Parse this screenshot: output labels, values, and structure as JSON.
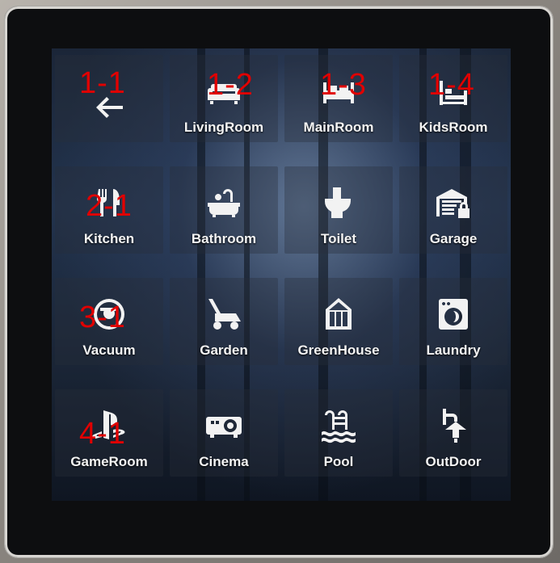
{
  "tiles": [
    {
      "id": "back",
      "label": "",
      "icon": "back-arrow-icon",
      "tag": "1-1"
    },
    {
      "id": "livingroom",
      "label": "LivingRoom",
      "icon": "sofa-icon",
      "tag": "1-2"
    },
    {
      "id": "mainroom",
      "label": "MainRoom",
      "icon": "bed-icon",
      "tag": "1-3"
    },
    {
      "id": "kidsroom",
      "label": "KidsRoom",
      "icon": "single-bed-icon",
      "tag": "1-4"
    },
    {
      "id": "kitchen",
      "label": "Kitchen",
      "icon": "fork-knife-icon",
      "tag": "2-1"
    },
    {
      "id": "bathroom",
      "label": "Bathroom",
      "icon": "bathtub-icon",
      "tag": ""
    },
    {
      "id": "toilet",
      "label": "Toilet",
      "icon": "toilet-icon",
      "tag": ""
    },
    {
      "id": "garage",
      "label": "Garage",
      "icon": "garage-lock-icon",
      "tag": ""
    },
    {
      "id": "vacuum",
      "label": "Vacuum",
      "icon": "robot-vacuum-icon",
      "tag": "3-1"
    },
    {
      "id": "garden",
      "label": "Garden",
      "icon": "lawn-mower-icon",
      "tag": ""
    },
    {
      "id": "greenhouse",
      "label": "GreenHouse",
      "icon": "greenhouse-icon",
      "tag": ""
    },
    {
      "id": "laundry",
      "label": "Laundry",
      "icon": "washing-machine-icon",
      "tag": ""
    },
    {
      "id": "gameroom",
      "label": "GameRoom",
      "icon": "playstation-icon",
      "tag": "4-1"
    },
    {
      "id": "cinema",
      "label": "Cinema",
      "icon": "projector-icon",
      "tag": ""
    },
    {
      "id": "pool",
      "label": "Pool",
      "icon": "pool-ladder-icon",
      "tag": ""
    },
    {
      "id": "outdoor",
      "label": "OutDoor",
      "icon": "outdoor-lamp-icon",
      "tag": ""
    }
  ]
}
